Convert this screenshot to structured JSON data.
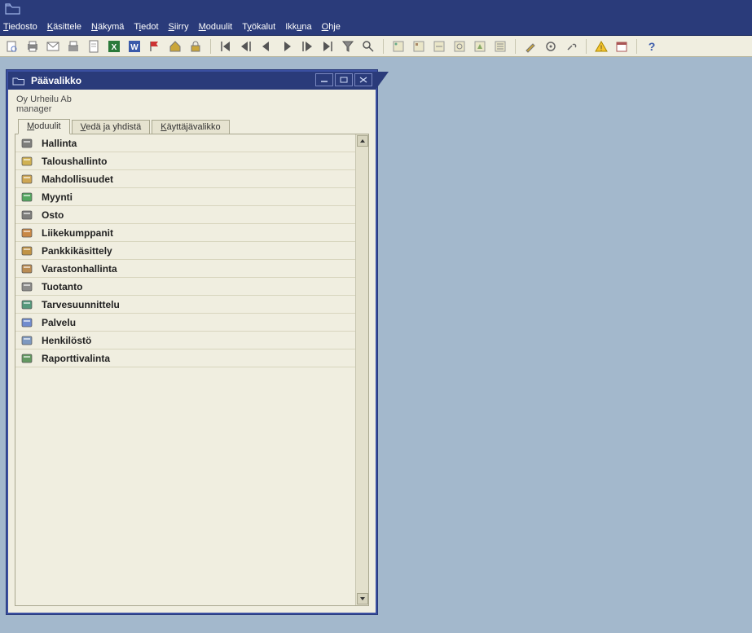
{
  "menubar": [
    {
      "pre": "",
      "u": "T",
      "post": "iedosto"
    },
    {
      "pre": "",
      "u": "K",
      "post": "äsittele"
    },
    {
      "pre": "",
      "u": "N",
      "post": "äkymä"
    },
    {
      "pre": "T",
      "u": "i",
      "post": "edot"
    },
    {
      "pre": "",
      "u": "S",
      "post": "iirry"
    },
    {
      "pre": "",
      "u": "M",
      "post": "oduulit"
    },
    {
      "pre": "T",
      "u": "y",
      "post": "ökalut"
    },
    {
      "pre": "Ikk",
      "u": "u",
      "post": "na"
    },
    {
      "pre": "",
      "u": "O",
      "post": "hje"
    }
  ],
  "toolbar_icons": [
    "preview-icon",
    "print-icon",
    "email-icon",
    "fax-icon",
    "document-icon",
    "excel-icon",
    "word-icon",
    "flag-icon",
    "home-icon",
    "lock-icon",
    "first-icon",
    "prev-record-icon",
    "prev-icon",
    "next-icon",
    "next-record-icon",
    "last-icon",
    "filter-icon",
    "find-icon",
    "form-a-icon",
    "form-b-icon",
    "form-c-icon",
    "form-d-icon",
    "form-e-icon",
    "form-f-icon",
    "edit-icon",
    "settings-icon",
    "tools-icon",
    "warning-icon",
    "calendar-icon",
    "help-icon"
  ],
  "window": {
    "title": "Päävalikko",
    "company": "Oy Urheilu Ab",
    "user": "manager"
  },
  "tabs": [
    {
      "pre": "",
      "u": "M",
      "post": "oduulit",
      "active": true
    },
    {
      "pre": "",
      "u": "V",
      "post": "edä ja yhdistä",
      "active": false
    },
    {
      "pre": "",
      "u": "K",
      "post": "äyttäjävalikko",
      "active": false
    }
  ],
  "modules": [
    {
      "icon": "admin-icon",
      "color": "#6a6a6a",
      "label": "Hallinta"
    },
    {
      "icon": "finance-icon",
      "color": "#caa63a",
      "label": "Taloushallinto"
    },
    {
      "icon": "opportunity-icon",
      "color": "#c99a3a",
      "label": "Mahdollisuudet"
    },
    {
      "icon": "sales-icon",
      "color": "#3a9a4a",
      "label": "Myynti"
    },
    {
      "icon": "purchase-icon",
      "color": "#6a6a6a",
      "label": "Osto"
    },
    {
      "icon": "partners-icon",
      "color": "#c2762a",
      "label": "Liikekumppanit"
    },
    {
      "icon": "banking-icon",
      "color": "#b8842a",
      "label": "Pankkikäsittely"
    },
    {
      "icon": "inventory-icon",
      "color": "#b07a3a",
      "label": "Varastonhallinta"
    },
    {
      "icon": "production-icon",
      "color": "#7a7a7a",
      "label": "Tuotanto"
    },
    {
      "icon": "mrp-icon",
      "color": "#3a8a6a",
      "label": "Tarvesuunnittelu"
    },
    {
      "icon": "service-icon",
      "color": "#5a7aca",
      "label": "Palvelu"
    },
    {
      "icon": "hr-icon",
      "color": "#6a8aba",
      "label": "Henkilöstö"
    },
    {
      "icon": "reports-icon",
      "color": "#4a8a4a",
      "label": "Raporttivalinta"
    }
  ]
}
